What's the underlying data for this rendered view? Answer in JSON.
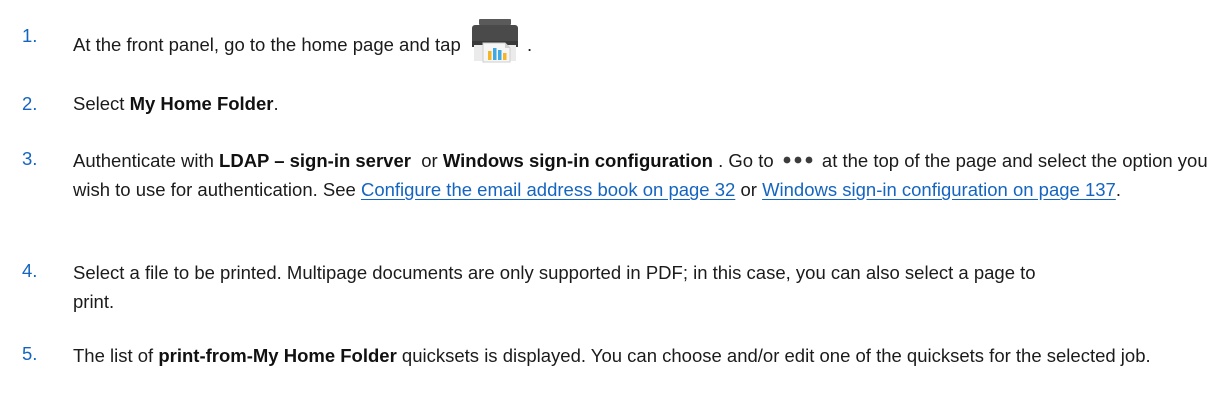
{
  "accent_color": "#1565c0",
  "steps": [
    {
      "number": "1.",
      "text_before_icon": "At the front panel, go to the home page and tap",
      "icon": "printer-icon",
      "text_after_icon": "."
    },
    {
      "number": "2.",
      "text_prefix": "Select ",
      "bold": "My Home Folder",
      "text_suffix": "."
    },
    {
      "number": "3.",
      "prefix": "Authenticate with ",
      "bold_1": "LDAP – sign-in server",
      "middle_1": "  or ",
      "bold_2": "Windows sign-in configuration",
      "middle_2": " . Go to",
      "icon": "more-options-icon",
      "middle_3": "at the top of the page and select the option you wish to use for authentication. See ",
      "link_1": "Configure the email address book on page 32",
      "middle_4": " or ",
      "link_2": "Windows sign-in configuration on page 137",
      "suffix": "."
    },
    {
      "number": "4.",
      "text": "Select a file to be printed. Multipage documents are only supported in PDF; in this case, you can also select a page to print."
    },
    {
      "number": "5.",
      "prefix": "The list of ",
      "bold": "print-from-My Home Folder",
      "suffix": " quicksets is displayed. You can choose and/or edit one of the quicksets for the selected job."
    }
  ]
}
